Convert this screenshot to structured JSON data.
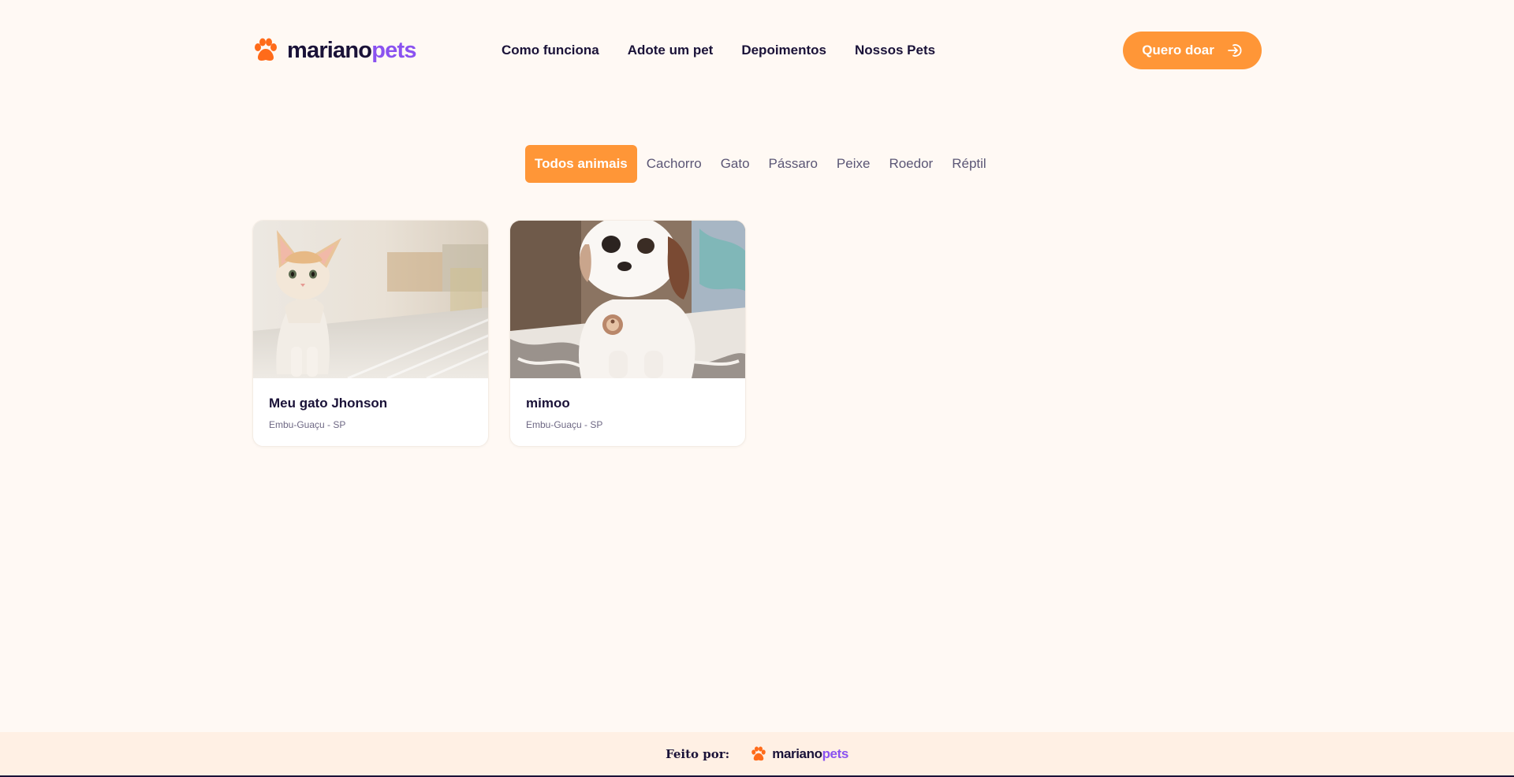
{
  "header": {
    "logo_part1": "mariano",
    "logo_part2": "pets",
    "logo_icon": "paw-icon",
    "nav": [
      {
        "label": "Como funciona"
      },
      {
        "label": "Adote um pet"
      },
      {
        "label": "Depoimentos"
      },
      {
        "label": "Nossos Pets"
      }
    ],
    "cta_label": "Quero doar",
    "cta_icon": "enter-arrow-icon"
  },
  "filters": {
    "options": [
      "Todos animais",
      "Cachorro",
      "Gato",
      "Pássaro",
      "Peixe",
      "Roedor",
      "Réptil"
    ],
    "selected": "Todos animais"
  },
  "pets": [
    {
      "name": "Meu gato Jhonson",
      "location": "Embu-Guaçu - SP",
      "photo": "kitten-photo"
    },
    {
      "name": "mimoo",
      "location": "Embu-Guaçu - SP",
      "photo": "dog-photo"
    }
  ],
  "footer": {
    "made_by": "Feito por:",
    "logo_part1": "mariano",
    "logo_part2": "pets"
  },
  "colors": {
    "background": "#fff9f4",
    "accent": "#ff9637",
    "brand_purple": "#8a52f0",
    "text_dark": "#1a1238",
    "footer_bg": "#fff0e4"
  }
}
